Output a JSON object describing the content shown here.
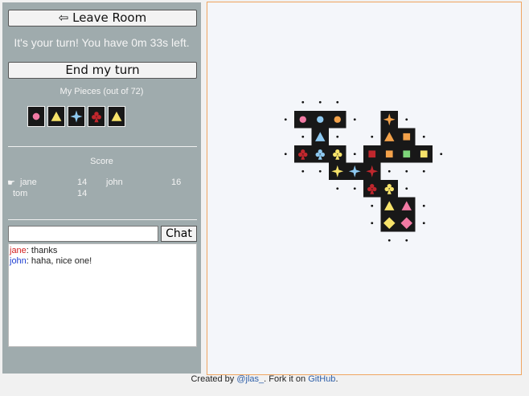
{
  "sidebar": {
    "leave_label": "⇦ Leave Room",
    "turn_message": "It's your turn! You have 0m 33s left.",
    "end_turn_label": "End my turn",
    "pieces_title": "My Pieces (out of 72)",
    "hand": [
      {
        "shape": "circle",
        "color": "#f27aa4"
      },
      {
        "shape": "triangle",
        "color": "#f7e36a"
      },
      {
        "shape": "star4",
        "color": "#8ec9f0"
      },
      {
        "shape": "club",
        "color": "#c0272d"
      },
      {
        "shape": "triangle",
        "color": "#f7e36a"
      }
    ],
    "score_title": "Score",
    "scores": [
      {
        "marker": "☛",
        "name": "jane",
        "score": "14"
      },
      {
        "marker": "",
        "name": "john",
        "score": "16"
      },
      {
        "marker": "",
        "name": "tom",
        "score": "14"
      }
    ]
  },
  "chat": {
    "input_value": "",
    "button_label": "Chat",
    "messages": [
      {
        "user": "jane",
        "user_color": "#d21f1f",
        "text": ": thanks"
      },
      {
        "user": "john",
        "user_color": "#1f3fd2",
        "text": ": haha, nice one!"
      }
    ]
  },
  "board": {
    "tiles": [
      {
        "c": 0,
        "r": 0,
        "shape": "circle",
        "color": "#f27aa4"
      },
      {
        "c": 1,
        "r": 0,
        "shape": "circle",
        "color": "#8ec9f0"
      },
      {
        "c": 2,
        "r": 0,
        "shape": "circle",
        "color": "#f3a24a"
      },
      {
        "c": 5,
        "r": 0,
        "shape": "star4",
        "color": "#f3a24a"
      },
      {
        "c": 1,
        "r": 1,
        "shape": "triangle",
        "color": "#8ec9f0"
      },
      {
        "c": 5,
        "r": 1,
        "shape": "triangle",
        "color": "#f3a24a"
      },
      {
        "c": 6,
        "r": 1,
        "shape": "square",
        "color": "#f3a24a"
      },
      {
        "c": 0,
        "r": 2,
        "shape": "club",
        "color": "#c0272d"
      },
      {
        "c": 1,
        "r": 2,
        "shape": "club",
        "color": "#8ec9f0"
      },
      {
        "c": 2,
        "r": 2,
        "shape": "club",
        "color": "#f7e36a"
      },
      {
        "c": 4,
        "r": 2,
        "shape": "square",
        "color": "#c0272d"
      },
      {
        "c": 5,
        "r": 2,
        "shape": "square",
        "color": "#f3a24a"
      },
      {
        "c": 6,
        "r": 2,
        "shape": "square",
        "color": "#7ed67a"
      },
      {
        "c": 7,
        "r": 2,
        "shape": "square",
        "color": "#f7e36a"
      },
      {
        "c": 2,
        "r": 3,
        "shape": "star4",
        "color": "#f7e36a"
      },
      {
        "c": 3,
        "r": 3,
        "shape": "star4",
        "color": "#8ec9f0"
      },
      {
        "c": 4,
        "r": 3,
        "shape": "star4",
        "color": "#c0272d"
      },
      {
        "c": 4,
        "r": 4,
        "shape": "club",
        "color": "#c0272d"
      },
      {
        "c": 5,
        "r": 4,
        "shape": "club",
        "color": "#f7e36a"
      },
      {
        "c": 5,
        "r": 5,
        "shape": "triangle",
        "color": "#f7e36a"
      },
      {
        "c": 6,
        "r": 5,
        "shape": "triangle",
        "color": "#f27aa4"
      },
      {
        "c": 5,
        "r": 6,
        "shape": "diamond",
        "color": "#f7e36a"
      },
      {
        "c": 6,
        "r": 6,
        "shape": "diamond",
        "color": "#f27aa4"
      }
    ],
    "dots": [
      [
        0,
        -1
      ],
      [
        1,
        -1
      ],
      [
        2,
        -1
      ],
      [
        -1,
        0
      ],
      [
        3,
        0
      ],
      [
        6,
        0
      ],
      [
        0,
        1
      ],
      [
        2,
        1
      ],
      [
        4,
        1
      ],
      [
        7,
        1
      ],
      [
        -1,
        2
      ],
      [
        3,
        2
      ],
      [
        8,
        2
      ],
      [
        0,
        3
      ],
      [
        1,
        3
      ],
      [
        5,
        3
      ],
      [
        6,
        3
      ],
      [
        7,
        3
      ],
      [
        2,
        4
      ],
      [
        3,
        4
      ],
      [
        6,
        4
      ],
      [
        4,
        5
      ],
      [
        7,
        5
      ],
      [
        4,
        6
      ],
      [
        7,
        6
      ],
      [
        5,
        7
      ],
      [
        6,
        7
      ]
    ]
  },
  "footer": {
    "prefix": "Created by ",
    "author": "@jlas_",
    "middle": ". Fork it on ",
    "github": "GitHub",
    "suffix": "."
  }
}
